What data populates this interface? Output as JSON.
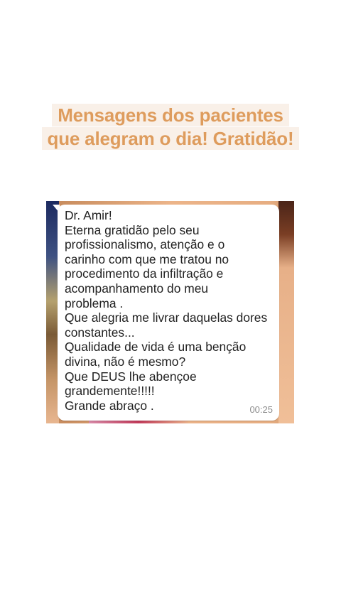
{
  "headline": {
    "lines": [
      "Mensagens dos pacientes",
      "que alegram o dia! Gratidão!"
    ]
  },
  "message": {
    "lines": [
      "Dr. Amir!",
      "Eterna gratidão pelo seu",
      "profissionalismo, atenção e o",
      "carinho com que me tratou no",
      "procedimento da infiltração  e",
      "acompanhamento do meu",
      "problema .",
      "Que alegria me livrar daquelas dores",
      "constantes...",
      "Qualidade de vida é uma benção",
      "divina, não é mesmo?",
      "Que DEUS lhe abençoe",
      "grandemente!!!!!",
      "Grande abraço ."
    ],
    "time": "00:25"
  },
  "colors": {
    "headline_text": "#de9c5d",
    "headline_bg": "#f9f0e8",
    "bubble_bg": "#ffffff",
    "time_text": "#8c8c8c"
  }
}
